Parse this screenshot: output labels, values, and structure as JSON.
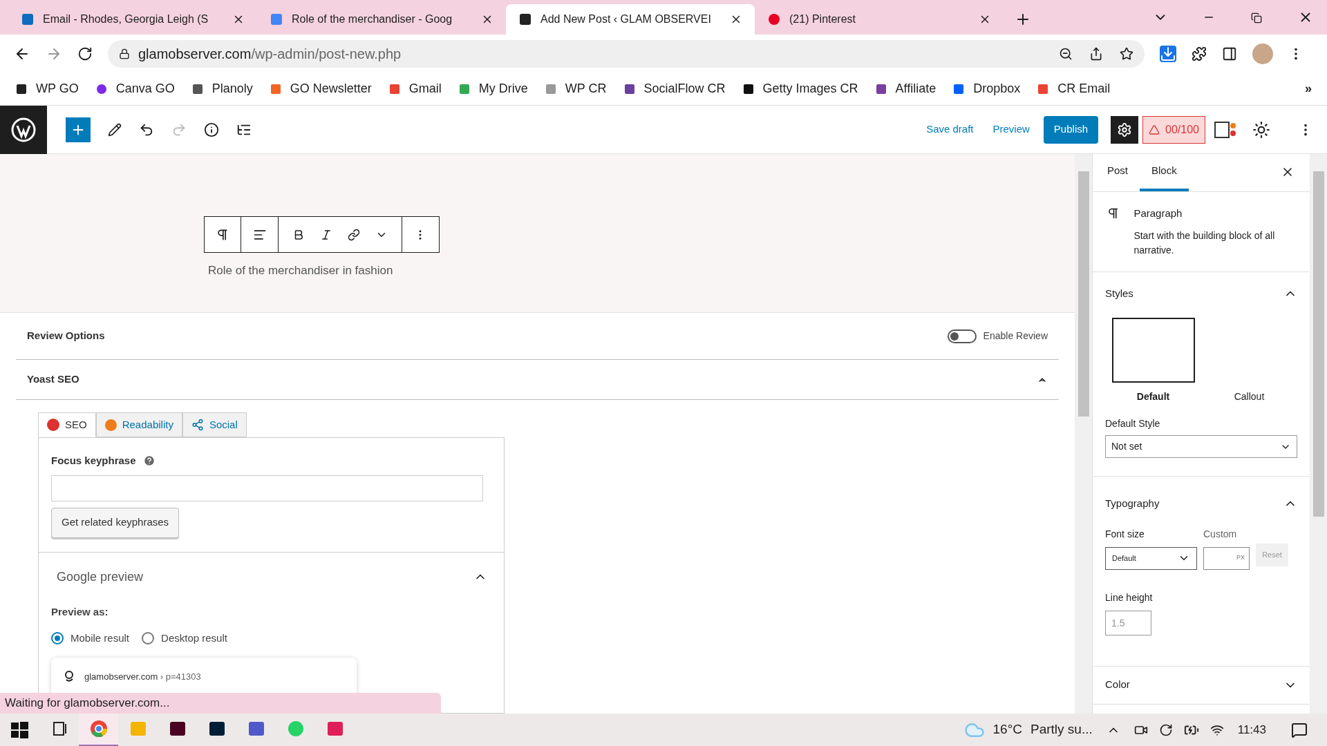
{
  "browser": {
    "tabs": [
      {
        "title": "Email - Rhodes, Georgia Leigh (S",
        "kind": "mail",
        "selected": false
      },
      {
        "title": "Role of the merchandiser - Goog",
        "kind": "doc",
        "selected": false
      },
      {
        "title": "Add New Post ‹ GLAM OBSERVEI",
        "kind": "site",
        "selected": true
      },
      {
        "title": "(21) Pinterest",
        "kind": "pin",
        "selected": false
      }
    ],
    "address": "glamobserver.com",
    "address_path": "/wp-admin/post-new.php",
    "bookmarks": [
      {
        "label": "WP GO",
        "kind": "site"
      },
      {
        "label": "Canva GO",
        "kind": "canva"
      },
      {
        "label": "Planoly",
        "kind": "planoly"
      },
      {
        "label": "GO Newsletter",
        "kind": "news"
      },
      {
        "label": "Gmail",
        "kind": "gmail"
      },
      {
        "label": "My Drive",
        "kind": "drive"
      },
      {
        "label": "WP CR",
        "kind": "feather"
      },
      {
        "label": "SocialFlow CR",
        "kind": "flow"
      },
      {
        "label": "Getty Images CR",
        "kind": "getty"
      },
      {
        "label": "Affiliate",
        "kind": "affiliate"
      },
      {
        "label": "Dropbox",
        "kind": "dropbox"
      },
      {
        "label": "CR Email",
        "kind": "gmail"
      }
    ],
    "more_bookmarks": "»"
  },
  "toolbar": {
    "save_draft": "Save draft",
    "preview": "Preview",
    "publish": "Publish",
    "score": "00/100"
  },
  "block_text": "Role of the merchandiser in fashion",
  "review": {
    "title": "Review Options",
    "toggle_label": "Enable Review",
    "on": false
  },
  "yoast": {
    "title": "Yoast SEO",
    "tabs": [
      {
        "label": "SEO",
        "kind": "seo",
        "selected": true
      },
      {
        "label": "Readability",
        "kind": "readability",
        "selected": false
      },
      {
        "label": "Social",
        "kind": "social",
        "selected": false
      }
    ],
    "focus_label": "Focus keyphrase",
    "related_button": "Get related keyphrases",
    "preview_title": "Google preview",
    "preview_as": "Preview as:",
    "radios": [
      {
        "label": "Mobile result",
        "selected": true
      },
      {
        "label": "Desktop result",
        "selected": false
      }
    ],
    "snippet_site": "glamobserver.com",
    "snippet_path": "› p=41303"
  },
  "sidebar": {
    "tabs": [
      {
        "label": "Post",
        "selected": false
      },
      {
        "label": "Block",
        "selected": true
      }
    ],
    "block_name": "Paragraph",
    "block_desc": "Start with the building block of all narrative.",
    "styles_title": "Styles",
    "styles": [
      {
        "label": "Default",
        "selected": true
      },
      {
        "label": "Callout",
        "selected": false
      }
    ],
    "default_style_label": "Default Style",
    "default_style_value": "Not set",
    "typography_title": "Typography",
    "font_size_label": "Font size",
    "custom_label": "Custom",
    "font_size_value": "Default",
    "unit": "PX",
    "reset": "Reset",
    "line_height_label": "Line height",
    "line_height_placeholder": "1.5",
    "color_title": "Color"
  },
  "status": "Waiting for glamobserver.com...",
  "taskbar": {
    "apps": [
      {
        "kind": "taskview",
        "selected": false
      },
      {
        "kind": "chrome",
        "selected": true
      },
      {
        "kind": "folder",
        "selected": false
      },
      {
        "kind": "indesign",
        "selected": false
      },
      {
        "kind": "photoshop",
        "selected": false
      },
      {
        "kind": "teams",
        "selected": false
      },
      {
        "kind": "whatsapp",
        "selected": false
      },
      {
        "kind": "slack",
        "selected": false
      }
    ],
    "temp": "16°C",
    "weather": "Partly su...",
    "time": "11:43"
  }
}
